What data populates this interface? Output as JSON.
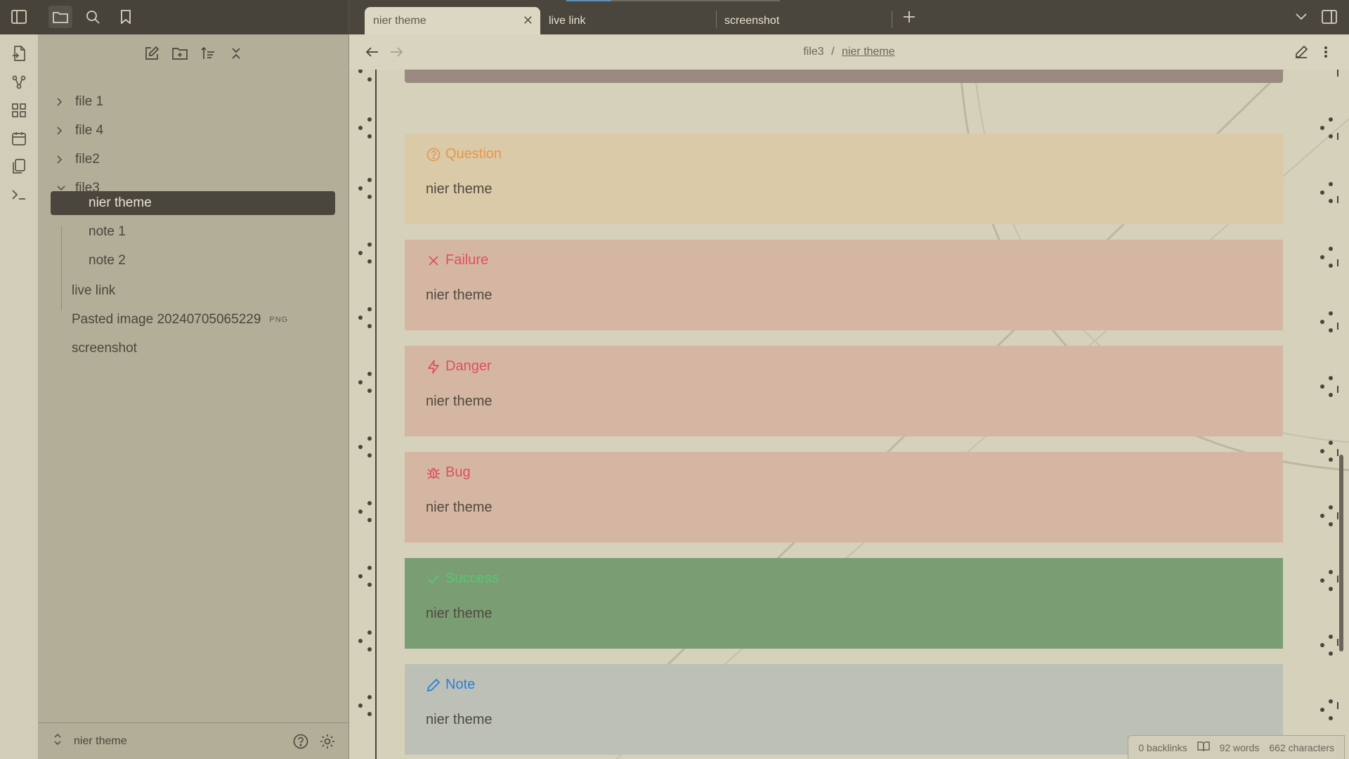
{
  "tabs": [
    {
      "label": "nier theme",
      "active": true
    },
    {
      "label": "live link",
      "active": false
    },
    {
      "label": "screenshot",
      "active": false
    }
  ],
  "sidebar": {
    "tree": [
      {
        "label": "file 1",
        "type": "folder",
        "expanded": false
      },
      {
        "label": "file 4",
        "type": "folder",
        "expanded": false
      },
      {
        "label": "file2",
        "type": "folder",
        "expanded": false
      },
      {
        "label": "file3",
        "type": "folder",
        "expanded": true
      },
      {
        "label": "nier theme",
        "type": "note",
        "selected": true
      },
      {
        "label": "note 1",
        "type": "note"
      },
      {
        "label": "note 2",
        "type": "note"
      },
      {
        "label": "live link",
        "type": "note"
      },
      {
        "label": "Pasted image 20240705065229",
        "type": "file",
        "badge": "PNG"
      },
      {
        "label": "screenshot",
        "type": "note"
      }
    ],
    "vault_name": "nier theme"
  },
  "breadcrumb": {
    "parent": "file3",
    "separator": "/",
    "current": "nier theme"
  },
  "callouts": [
    {
      "title": "Question",
      "body": "nier theme",
      "icon": "question-circle-icon",
      "title_color": "#e8964a",
      "bg": "#d9c7a6"
    },
    {
      "title": "Failure",
      "body": "nier theme",
      "icon": "x-icon",
      "title_color": "#e0505a",
      "bg": "#d4b5a2"
    },
    {
      "title": "Danger",
      "body": "nier theme",
      "icon": "zap-icon",
      "title_color": "#e0505a",
      "bg": "#d4b5a2"
    },
    {
      "title": "Bug",
      "body": "nier theme",
      "icon": "bug-icon",
      "title_color": "#e0505a",
      "bg": "#d4b5a2"
    },
    {
      "title": "Success",
      "body": "nier theme",
      "icon": "check-icon",
      "title_color": "#55c775",
      "bg": "#7a9c72"
    },
    {
      "title": "Note",
      "body": "nier theme",
      "icon": "pencil-icon",
      "title_color": "#2d7fd6",
      "bg": "#bbbfb5"
    }
  ],
  "status": {
    "backlinks": "0 backlinks",
    "words": "92 words",
    "characters": "662 characters"
  },
  "colors": {
    "dark": "#4a463d",
    "sidebar": "#b3ae98",
    "main": "#d6d1bb"
  }
}
